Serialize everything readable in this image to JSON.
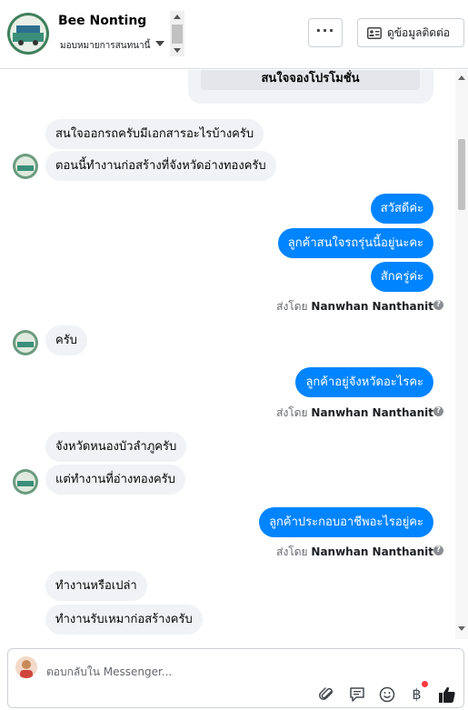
{
  "header": {
    "page_name": "Bee Nonting",
    "assignment": "มอบหมายการสนทนานี้",
    "more_label": "···",
    "contact_label": "ดูข้อมูลติดต่อ"
  },
  "chat": {
    "card_button": "สนใจจองโปรโมชั่น",
    "messages": [
      {
        "side": "in",
        "text": "สนใจออกรถครับมีเอกสารอะไรบ้างครับ"
      },
      {
        "side": "in",
        "text": "ตอนนี้ทำงานก่อสร้างที่จังหวัดอ่างทองครับ"
      },
      {
        "side": "out",
        "text": "สวัสดีค่ะ"
      },
      {
        "side": "out",
        "text": "ลูกค้าสนใจรถรุ่นนี้อยู่นะคะ"
      },
      {
        "side": "out",
        "text": "สักครู่ค่ะ"
      },
      {
        "side": "in",
        "text": "ครับ"
      },
      {
        "side": "out",
        "text": "ลูกค้าอยู่จังหวัดอะไรคะ"
      },
      {
        "side": "in",
        "text": "จังหวัดหนองบัวลำภูครับ"
      },
      {
        "side": "in",
        "text": "แต่ทำงานที่อ่างทองครับ"
      },
      {
        "side": "out",
        "text": "ลูกค้าประกอบอาชีพอะไรอยู่คะ"
      },
      {
        "side": "in",
        "text": "ทำงานหรือเปล่า"
      },
      {
        "side": "in",
        "text": "ทำงานรับเหมาก่อสร้างครับ"
      }
    ],
    "sent_by_prefix": "ส่งโดย",
    "sent_by_name": "Nanwhan Nanthanit"
  },
  "composer": {
    "placeholder": "ตอบกลับใน Messenger..."
  },
  "icons": [
    "paperclip-icon",
    "saved-reply-icon",
    "emoji-icon",
    "baht-icon",
    "thumbs-up-icon",
    "id-card-icon",
    "help-icon"
  ],
  "colors": {
    "outgoing": "#0084ff",
    "incoming": "#f0f2f5",
    "notification_dot": "#fa383e"
  }
}
